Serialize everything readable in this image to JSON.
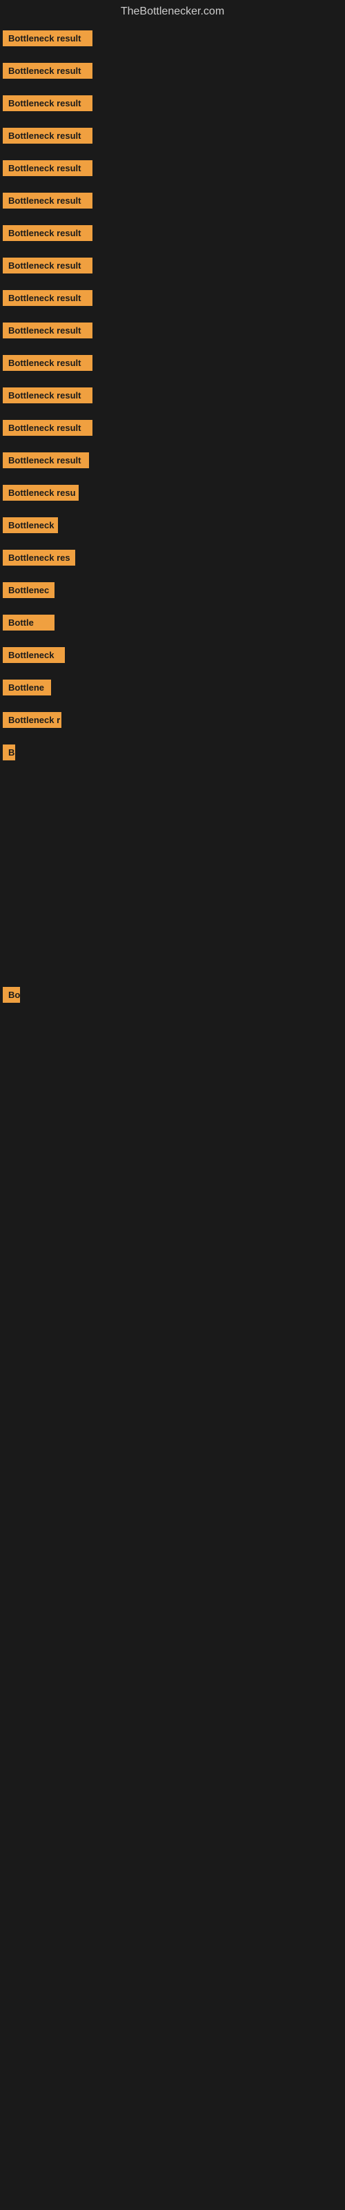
{
  "site": {
    "title": "TheBottlenecker.com"
  },
  "rows": [
    {
      "id": 1,
      "label": "Bottleneck result"
    },
    {
      "id": 2,
      "label": "Bottleneck result"
    },
    {
      "id": 3,
      "label": "Bottleneck result"
    },
    {
      "id": 4,
      "label": "Bottleneck result"
    },
    {
      "id": 5,
      "label": "Bottleneck result"
    },
    {
      "id": 6,
      "label": "Bottleneck result"
    },
    {
      "id": 7,
      "label": "Bottleneck result"
    },
    {
      "id": 8,
      "label": "Bottleneck result"
    },
    {
      "id": 9,
      "label": "Bottleneck result"
    },
    {
      "id": 10,
      "label": "Bottleneck result"
    },
    {
      "id": 11,
      "label": "Bottleneck result"
    },
    {
      "id": 12,
      "label": "Bottleneck result"
    },
    {
      "id": 13,
      "label": "Bottleneck result"
    },
    {
      "id": 14,
      "label": "Bottleneck result"
    },
    {
      "id": 15,
      "label": "Bottleneck resu"
    },
    {
      "id": 16,
      "label": "Bottleneck"
    },
    {
      "id": 17,
      "label": "Bottleneck res"
    },
    {
      "id": 18,
      "label": "Bottlenec"
    },
    {
      "id": 19,
      "label": "Bottle"
    },
    {
      "id": 20,
      "label": "Bottleneck"
    },
    {
      "id": 21,
      "label": "Bottlene"
    },
    {
      "id": 22,
      "label": "Bottleneck r"
    },
    {
      "id": 23,
      "label": "B"
    },
    {
      "id": 24,
      "label": ""
    },
    {
      "id": 25,
      "label": ""
    },
    {
      "id": 26,
      "label": ""
    },
    {
      "id": 27,
      "label": "Bo"
    },
    {
      "id": 28,
      "label": ""
    },
    {
      "id": 29,
      "label": ""
    },
    {
      "id": 30,
      "label": ""
    },
    {
      "id": 31,
      "label": ""
    }
  ],
  "colors": {
    "background": "#1a1a1a",
    "badge": "#f0a040",
    "title": "#cccccc"
  }
}
